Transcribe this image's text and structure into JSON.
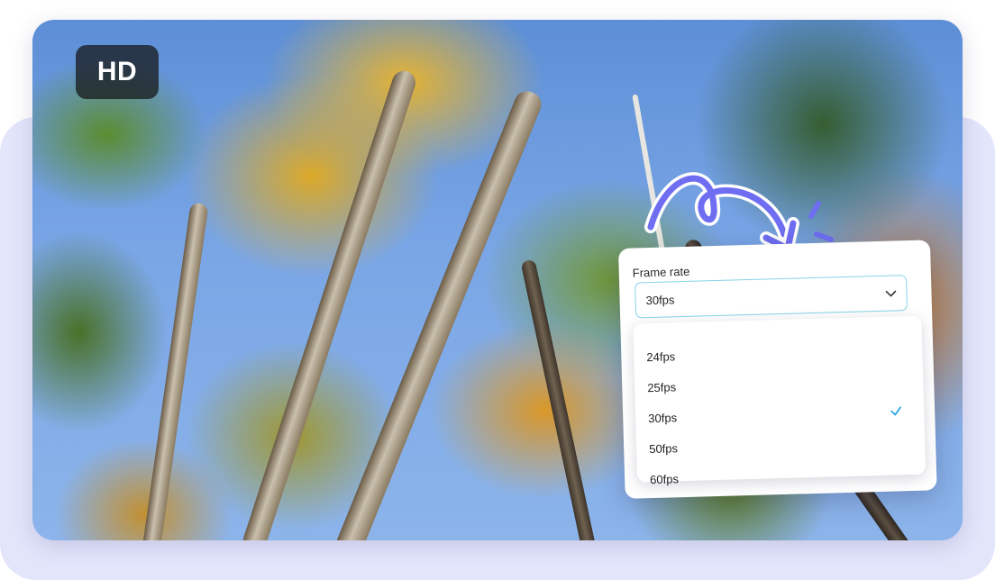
{
  "badge": {
    "label": "HD"
  },
  "frame_rate": {
    "label": "Frame rate",
    "selected": "30fps",
    "options": [
      "24fps",
      "25fps",
      "30fps",
      "50fps",
      "60fps"
    ]
  },
  "icons": {
    "dropdown": "chevron-down-icon",
    "selected": "check-icon",
    "decoration": "curved-arrow-icon"
  },
  "colors": {
    "accent": "#6f6ef2",
    "select_border": "#86d3e6",
    "check": "#2aa8e0",
    "backdrop": "#e3e5fb"
  }
}
